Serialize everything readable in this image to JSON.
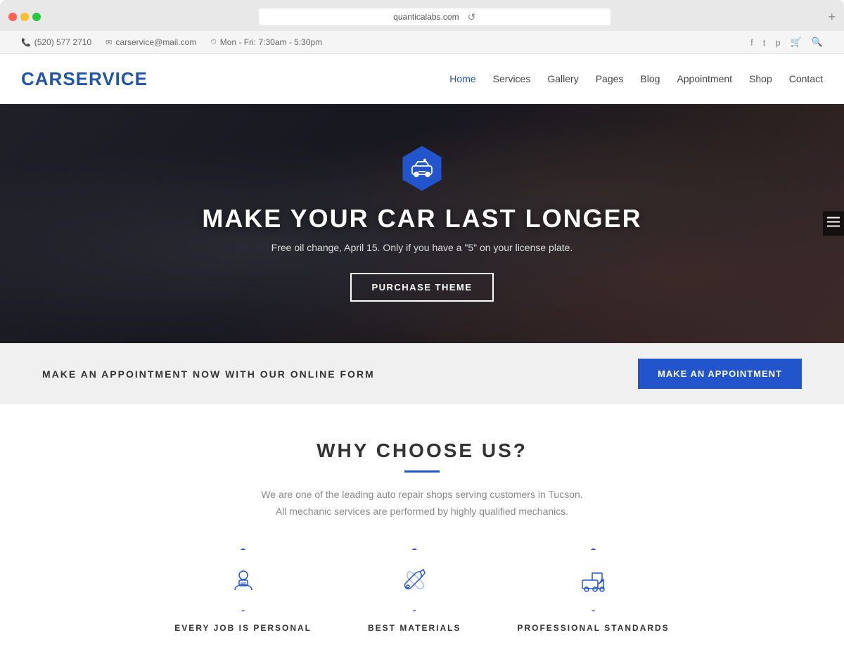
{
  "browser": {
    "url": "quanticalabs.com",
    "new_tab_icon": "+"
  },
  "topbar": {
    "phone": "(520) 577 2710",
    "email": "carservice@mail.com",
    "hours": "Mon - Fri: 7:30am - 5:30pm",
    "social": [
      "f",
      "t",
      "p",
      "🛒",
      "🔍"
    ]
  },
  "nav": {
    "logo": "CARSERVICE",
    "links": [
      {
        "label": "Home",
        "active": true
      },
      {
        "label": "Services"
      },
      {
        "label": "Gallery"
      },
      {
        "label": "Pages"
      },
      {
        "label": "Blog"
      },
      {
        "label": "Appointment"
      },
      {
        "label": "Shop"
      },
      {
        "label": "Contact"
      }
    ]
  },
  "hero": {
    "title": "MAKE YOUR CAR LAST LONGER",
    "subtitle": "Free oil change, April 15. Only if you have a \"5\" on your license plate.",
    "button_label": "PURCHASE THEME"
  },
  "appointment_banner": {
    "text": "MAKE AN APPOINTMENT NOW WITH OUR ONLINE FORM",
    "button_label": "MAKE AN APPOINTMENT"
  },
  "why_section": {
    "title": "WHY CHOOSE US?",
    "description_line1": "We are one of the leading auto repair shops serving customers in Tucson.",
    "description_line2": "All mechanic services are performed by highly qualified mechanics.",
    "features": [
      {
        "label": "EVERY JOB IS PERSONAL",
        "icon": "person"
      },
      {
        "label": "BEST MATERIALS",
        "icon": "wrench"
      },
      {
        "label": "PROFESSIONAL STANDARDS",
        "icon": "truck"
      }
    ]
  }
}
